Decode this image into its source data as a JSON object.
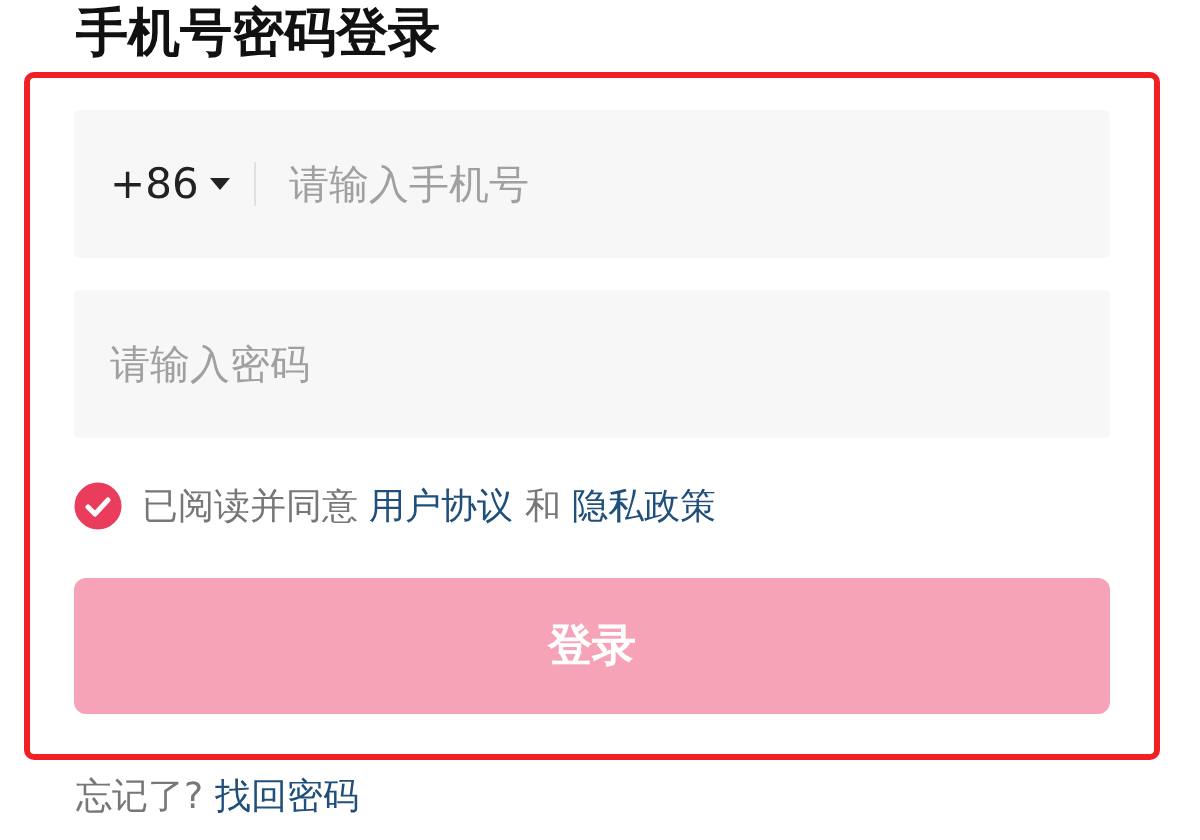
{
  "title": "手机号密码登录",
  "phone": {
    "country_code": "+86",
    "placeholder": "请输入手机号"
  },
  "password": {
    "placeholder": "请输入密码"
  },
  "agreement": {
    "checked": true,
    "text": "已阅读并同意",
    "link_1": "用户协议",
    "joiner": "和",
    "link_2": "隐私政策"
  },
  "login_button": {
    "label": "登录",
    "disabled": true
  },
  "forgot": {
    "text": "忘记了?",
    "link": "找回密码"
  }
}
